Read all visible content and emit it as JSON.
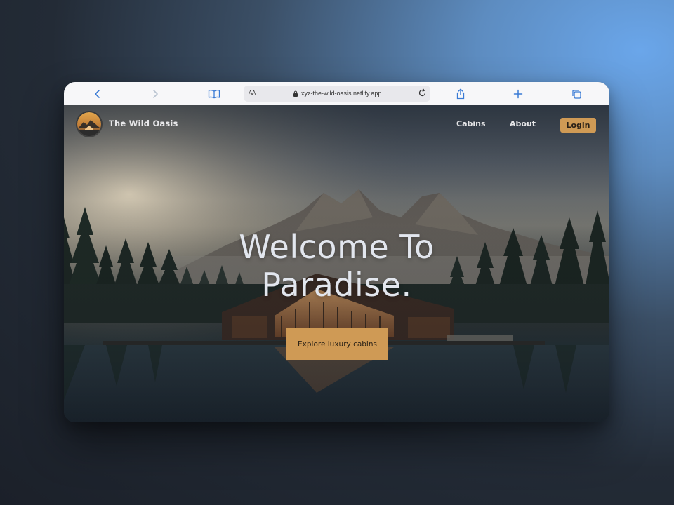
{
  "browser": {
    "address_text_size_label": "AA",
    "url": "xyz-the-wild-oasis.netlify.app",
    "icons": [
      "back-icon",
      "forward-icon",
      "bookmarks-icon",
      "lock-icon",
      "reload-icon",
      "share-icon",
      "new-tab-icon",
      "tabs-icon"
    ]
  },
  "site": {
    "brand": "The Wild Oasis",
    "nav": {
      "cabins": "Cabins",
      "about": "About",
      "login": "Login"
    },
    "hero": {
      "title_line1": "Welcome To",
      "title_line2": "Paradise.",
      "cta": "Explore luxury cabins"
    }
  },
  "colors": {
    "accent": "#cf9a55",
    "hero_text": "#e2e6ee",
    "toolbar_bg": "#f7f7f9"
  }
}
